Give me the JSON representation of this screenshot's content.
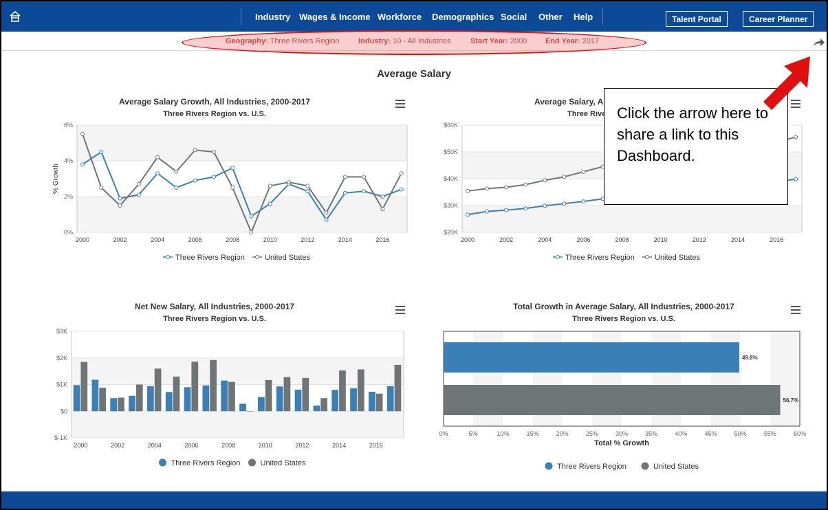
{
  "nav": {
    "items": [
      "Industry",
      "Wages & Income",
      "Workforce",
      "Demographics",
      "Social",
      "Other",
      "Help"
    ],
    "buttons": [
      "Talent Portal",
      "Career Planner"
    ],
    "home_icon": "home-icon"
  },
  "filters": [
    {
      "label": "Geography:",
      "value": "Three Rivers Region"
    },
    {
      "label": "Industry:",
      "value": "10 - All Industries"
    },
    {
      "label": "Start Year:",
      "value": "2000"
    },
    {
      "label": "End Year:",
      "value": "2017"
    }
  ],
  "page_title": "Average Salary",
  "callout_text": "Click the arrow here to share a link to this Dashboard.",
  "colors": {
    "region": "#3a7fb6",
    "us": "#6f7475",
    "nav": "#0c4a97",
    "annotation": "#e01010"
  },
  "chart_data": [
    {
      "type": "line",
      "title": "Average Salary Growth, All Industries, 2000-2017",
      "subtitle": "Three Rivers Region vs. U.S.",
      "ylabel": "% Growth",
      "ylim": [
        0,
        6
      ],
      "yticks": [
        "0%",
        "2%",
        "4%",
        "6%"
      ],
      "xticks": [
        "2000",
        "2002",
        "2004",
        "2006",
        "2008",
        "2010",
        "2012",
        "2014",
        "2016"
      ],
      "x": [
        2000,
        2001,
        2002,
        2003,
        2004,
        2005,
        2006,
        2007,
        2008,
        2009,
        2010,
        2011,
        2012,
        2013,
        2014,
        2015,
        2016,
        2017
      ],
      "series": [
        {
          "name": "Three Rivers Region",
          "values": [
            3.8,
            4.5,
            1.9,
            2.1,
            3.3,
            2.5,
            2.9,
            3.1,
            3.6,
            0.9,
            1.6,
            2.7,
            2.3,
            0.7,
            2.2,
            2.3,
            2.0,
            2.4
          ]
        },
        {
          "name": "United States",
          "values": [
            5.5,
            2.5,
            1.5,
            2.7,
            4.2,
            3.4,
            4.6,
            4.5,
            2.5,
            0.0,
            2.6,
            2.8,
            2.6,
            1.1,
            3.1,
            3.1,
            1.3,
            3.3
          ]
        }
      ]
    },
    {
      "type": "line",
      "title": "Average Salary, All Industries, 2000-2017",
      "subtitle": "Three Rivers Region vs. U.S.",
      "ylim": [
        20000,
        60000
      ],
      "yticks": [
        "$20K",
        "$30K",
        "$40K",
        "$50K",
        "$60K"
      ],
      "xticks": [
        "2000",
        "2002",
        "2004",
        "2006",
        "2008",
        "2010",
        "2012",
        "2014",
        "2016"
      ],
      "x": [
        2000,
        2001,
        2002,
        2003,
        2004,
        2005,
        2006,
        2007,
        2008,
        2009,
        2010,
        2011,
        2012,
        2013,
        2014,
        2015,
        2016,
        2017
      ],
      "series": [
        {
          "name": "Three Rivers Region",
          "values": [
            26600,
            27800,
            28300,
            28900,
            29900,
            30700,
            31500,
            32500,
            33600,
            33900,
            34500,
            35400,
            36200,
            36500,
            37300,
            38200,
            38900,
            39800
          ]
        },
        {
          "name": "United States",
          "values": [
            35400,
            36300,
            36800,
            37800,
            39400,
            40700,
            42600,
            44500,
            45600,
            45600,
            46800,
            48100,
            49300,
            49900,
            51400,
            53000,
            53700,
            55500
          ]
        }
      ]
    },
    {
      "type": "bar",
      "title": "Net New Salary, All Industries, 2000-2017",
      "subtitle": "Three Rivers Region vs. U.S.",
      "ylim": [
        -1000,
        3000
      ],
      "yticks": [
        "$-1K",
        "$0",
        "$1K",
        "$2K",
        "$3K"
      ],
      "xticks": [
        "2000",
        "2002",
        "2004",
        "2006",
        "2008",
        "2010",
        "2012",
        "2014",
        "2016"
      ],
      "categories": [
        2000,
        2001,
        2002,
        2003,
        2004,
        2005,
        2006,
        2007,
        2008,
        2009,
        2010,
        2011,
        2012,
        2013,
        2014,
        2015,
        2016,
        2017
      ],
      "series": [
        {
          "name": "Three Rivers Region",
          "values": [
            980,
            1180,
            490,
            580,
            940,
            720,
            900,
            970,
            1150,
            280,
            530,
            930,
            810,
            210,
            800,
            860,
            730,
            940
          ]
        },
        {
          "name": "United States",
          "values": [
            1850,
            880,
            510,
            1000,
            1600,
            1300,
            1860,
            1920,
            1100,
            0,
            1170,
            1280,
            1250,
            490,
            1530,
            1570,
            660,
            1740
          ]
        }
      ]
    },
    {
      "type": "bar",
      "orientation": "horizontal",
      "title": "Total Growth in Average Salary, All Industries, 2000-2017",
      "subtitle": "Three Rivers Region vs. U.S.",
      "xlabel": "Total % Growth",
      "xlim": [
        0,
        60
      ],
      "xticks": [
        "0%",
        "5%",
        "10%",
        "15%",
        "20%",
        "25%",
        "30%",
        "35%",
        "40%",
        "45%",
        "50%",
        "55%",
        "60%"
      ],
      "series": [
        {
          "name": "Three Rivers Region",
          "values": [
            49.8
          ],
          "label": "49.8%"
        },
        {
          "name": "United States",
          "values": [
            56.7
          ],
          "label": "56.7%"
        }
      ]
    }
  ]
}
